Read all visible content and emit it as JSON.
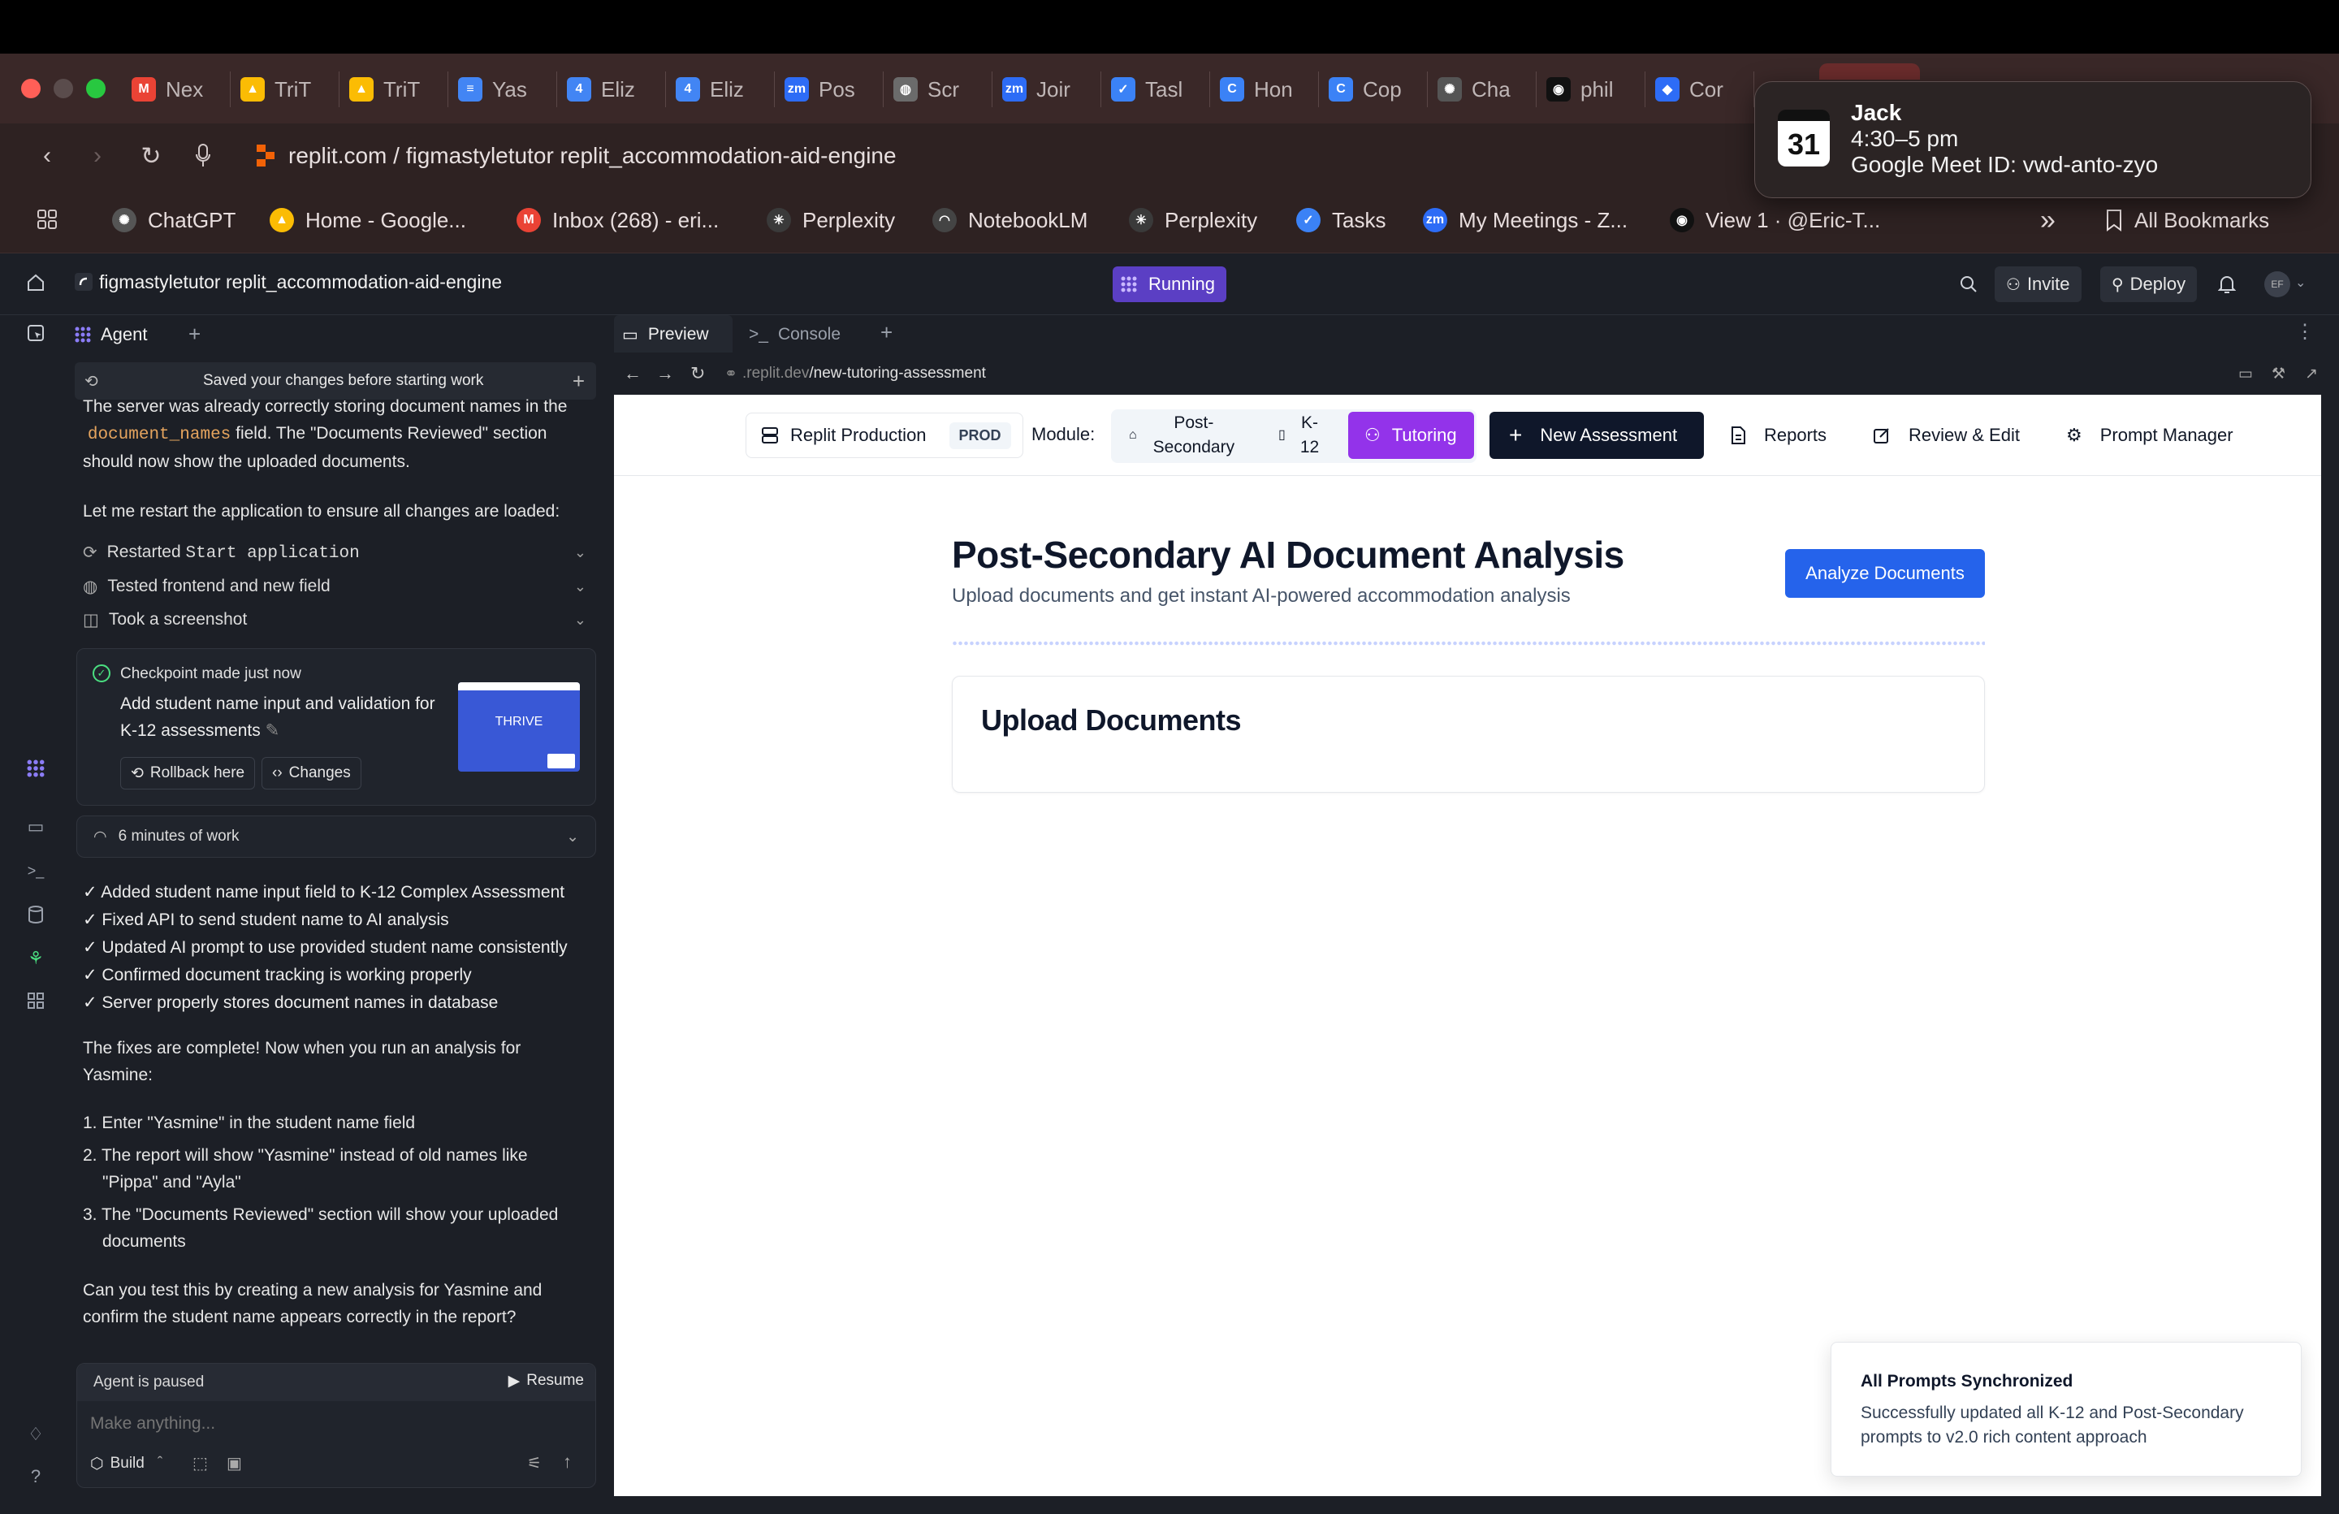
{
  "browser": {
    "tabs": [
      {
        "label": "Nex",
        "icon": "gmail-icon",
        "color": "#ea4335",
        "glyph": "M"
      },
      {
        "label": "TriT",
        "icon": "drive-icon",
        "color": "#fbbc04",
        "glyph": "▲"
      },
      {
        "label": "TriT",
        "icon": "drive-icon",
        "color": "#fbbc04",
        "glyph": "▲"
      },
      {
        "label": "Yas",
        "icon": "docs-icon",
        "color": "#4285f4",
        "glyph": "≡"
      },
      {
        "label": "Eliz",
        "icon": "calendar-four-icon",
        "color": "#4285f4",
        "glyph": "4"
      },
      {
        "label": "Eliz",
        "icon": "calendar-four-icon",
        "color": "#4285f4",
        "glyph": "4"
      },
      {
        "label": "Pos",
        "icon": "zoom-icon",
        "color": "#2d6cf6",
        "glyph": "zm"
      },
      {
        "label": "Scr",
        "icon": "globe-icon",
        "color": "#6b6b6b",
        "glyph": "◍"
      },
      {
        "label": "Joir",
        "icon": "zoom-icon",
        "color": "#2d6cf6",
        "glyph": "zm"
      },
      {
        "label": "Tasl",
        "icon": "tasks-icon",
        "color": "#3b82f6",
        "glyph": "✓"
      },
      {
        "label": "Hon",
        "icon": "copilot-icon",
        "color": "#3b82f6",
        "glyph": "C"
      },
      {
        "label": "Cop",
        "icon": "copilot-icon",
        "color": "#3b82f6",
        "glyph": "C"
      },
      {
        "label": "Cha",
        "icon": "openai-icon",
        "color": "#555555",
        "glyph": "✺"
      },
      {
        "label": "phil",
        "icon": "github-icon",
        "color": "#111111",
        "glyph": "◉"
      },
      {
        "label": "Cor",
        "icon": "app-icon",
        "color": "#2d6cf6",
        "glyph": "◆"
      }
    ],
    "url": "replit.com / figmastyletutor replit_accommodation-aid-engine",
    "bookmarks": [
      {
        "label": "ChatGPT",
        "icon": "openai-icon"
      },
      {
        "label": "Home - Google...",
        "icon": "drive-icon"
      },
      {
        "label": "Inbox (268) - eri...",
        "icon": "gmail-icon"
      },
      {
        "label": "Perplexity",
        "icon": "perplexity-icon"
      },
      {
        "label": "NotebookLM",
        "icon": "notebooklm-icon"
      },
      {
        "label": "Perplexity",
        "icon": "perplexity-icon"
      },
      {
        "label": "Tasks",
        "icon": "tasks-icon"
      },
      {
        "label": "My Meetings - Z...",
        "icon": "zoom-icon"
      },
      {
        "label": "View 1 · @Eric-T...",
        "icon": "github-icon"
      }
    ],
    "more_label": "»",
    "all_bookmarks": "All Bookmarks"
  },
  "notification": {
    "title": "Jack",
    "time": "4:30–5 pm",
    "detail": "Google Meet ID: vwd-anto-zyo",
    "calendar_day": "31"
  },
  "replit": {
    "project_title": "figmastyletutor replit_accommodation-aid-engine",
    "status": "Running",
    "invite": "Invite",
    "deploy": "Deploy",
    "avatar": "EF"
  },
  "agent": {
    "tab_label": "Agent",
    "saved_banner": "Saved your changes before starting work",
    "intro_a": "The server was already correctly storing document names in the",
    "intro_code": "document_names",
    "intro_b": " field. The \"Documents Reviewed\" section should now show the uploaded documents.",
    "restart_msg": "Let me restart the application to ensure all changes are loaded:",
    "actions": [
      {
        "prefix": "Restarted ",
        "code": "Start application",
        "icon": "restart-icon"
      },
      {
        "prefix": "Tested frontend and new field",
        "code": "",
        "icon": "globe-icon"
      },
      {
        "prefix": "Took a screenshot",
        "code": "",
        "icon": "camera-icon"
      }
    ],
    "checkpoint": {
      "label": "Checkpoint made just now",
      "title": "Add student name input and validation for K-12 assessments",
      "rollback": "Rollback here",
      "changes": "Changes",
      "thumb_text": "THRIVE"
    },
    "work_time": "6 minutes of work",
    "checklist": [
      "✓ Added student name input field to K-12 Complex Assessment",
      "✓ Fixed API to send student name to AI analysis",
      "✓ Updated AI prompt to use provided student name consistently",
      "✓ Confirmed document tracking is working properly",
      "✓ Server properly stores document names in database"
    ],
    "fixes_line_1": "The fixes are complete! Now when you run an analysis for",
    "fixes_line_2": "Yasmine:",
    "steps": [
      {
        "num": "1.",
        "line1": "Enter \"Yasmine\" in the student name field",
        "line2": ""
      },
      {
        "num": "2.",
        "line1": "The report will show \"Yasmine\" instead of old names like",
        "line2": "\"Pippa\" and \"Ayla\""
      },
      {
        "num": "3.",
        "line1": "The \"Documents Reviewed\" section will show your uploaded",
        "line2": "documents"
      }
    ],
    "question_1": "Can you test this by creating a new analysis for Yasmine and",
    "question_2": "confirm the student name appears correctly in the report?",
    "paused_label": "Agent is paused",
    "resume": "Resume",
    "input_placeholder": "Make anything...",
    "build_label": "Build"
  },
  "preview": {
    "tab_preview": "Preview",
    "tab_console": "Console",
    "url_host": ".replit.dev",
    "url_path": "/new-tutoring-assessment"
  },
  "app": {
    "env_label": "Replit Production",
    "env_badge": "PROD",
    "module_label": "Module:",
    "module_post_1": "Post-",
    "module_post_2": "Secondary",
    "module_k12_1": "K-",
    "module_k12_2": "12",
    "tutoring": "Tutoring",
    "new_assessment": "New Assessment",
    "reports": "Reports",
    "review_edit": "Review & Edit",
    "prompt_manager": "Prompt Manager",
    "heading": "Post-Secondary AI Document Analysis",
    "subheading": "Upload documents and get instant AI-powered accommodation analysis",
    "analyze_button": "Analyze Documents",
    "upload_title": "Upload Documents"
  },
  "toast": {
    "title": "All Prompts Synchronized",
    "message": "Successfully updated all K-12 and Post-Secondary prompts to v2.0 rich content approach"
  },
  "colors": {
    "running": "#5b3fc4",
    "tutoring": "#9333ea",
    "analyze": "#2563eb",
    "new_assessment": "#0f172a"
  }
}
